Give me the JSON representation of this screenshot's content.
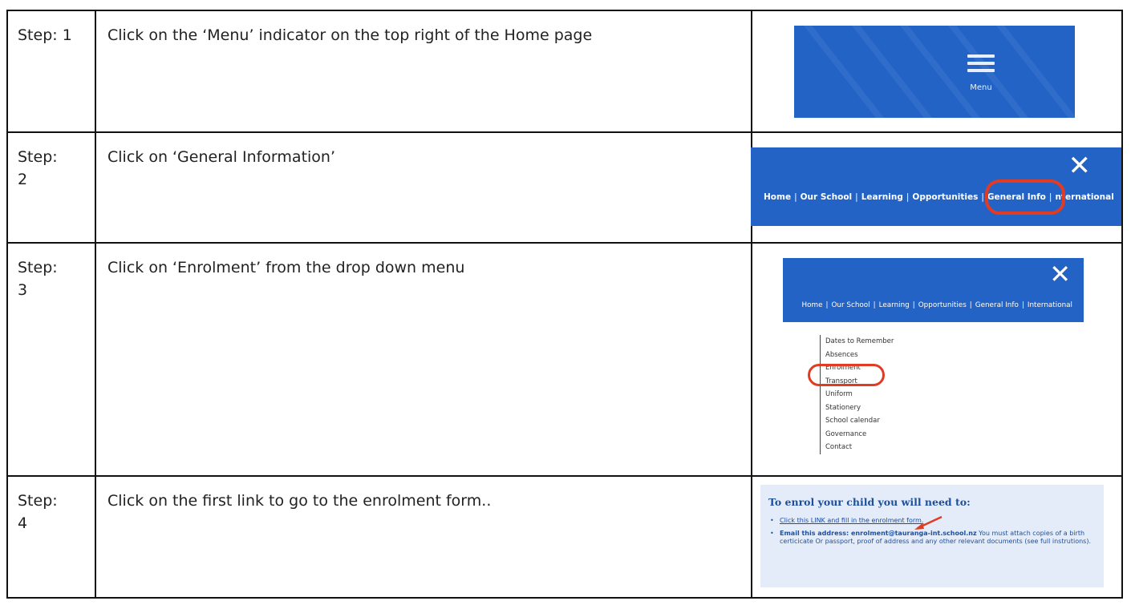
{
  "steps": [
    {
      "label": "Step: 1",
      "text": "Click on the ‘Menu’ indicator on the top right of the Home page"
    },
    {
      "label": "Step: 2",
      "text": "Click on ‘General Information’"
    },
    {
      "label": "Step: 3",
      "text": "Click on ‘Enrolment’ from the drop down menu"
    },
    {
      "label": "Step: 4",
      "text": "Click on the first link to go to the enrolment form.."
    }
  ],
  "shot1": {
    "menu_label": "Menu"
  },
  "shot2": {
    "nav": [
      "Home",
      "Our School",
      "Learning",
      "Opportunities",
      "General Info",
      "nternational"
    ]
  },
  "shot3": {
    "nav": [
      "Home",
      "Our School",
      "Learning",
      "Opportunities",
      "General Info",
      "International"
    ],
    "dropdown": [
      "Dates to Remember",
      "Absences",
      "Enrolment",
      "Transport",
      "Uniform",
      "Stationery",
      "School calendar",
      "Governance",
      "Contact"
    ]
  },
  "shot4": {
    "heading": "To enrol your child you will need to:",
    "bullet1_link": "Click this LINK and fill in the enrolment form.",
    "bullet2_lead": "Email this address: enrolment@tauranga-int.school.nz",
    "bullet2_rest": " You must attach copies of a birth certicicate Or passport, proof of address and any other relevant documents (see full instrutions)."
  },
  "colors": {
    "banner_blue": "#2463c6",
    "highlight_red": "#e23b24",
    "panel_bg": "#e3ecf8"
  }
}
